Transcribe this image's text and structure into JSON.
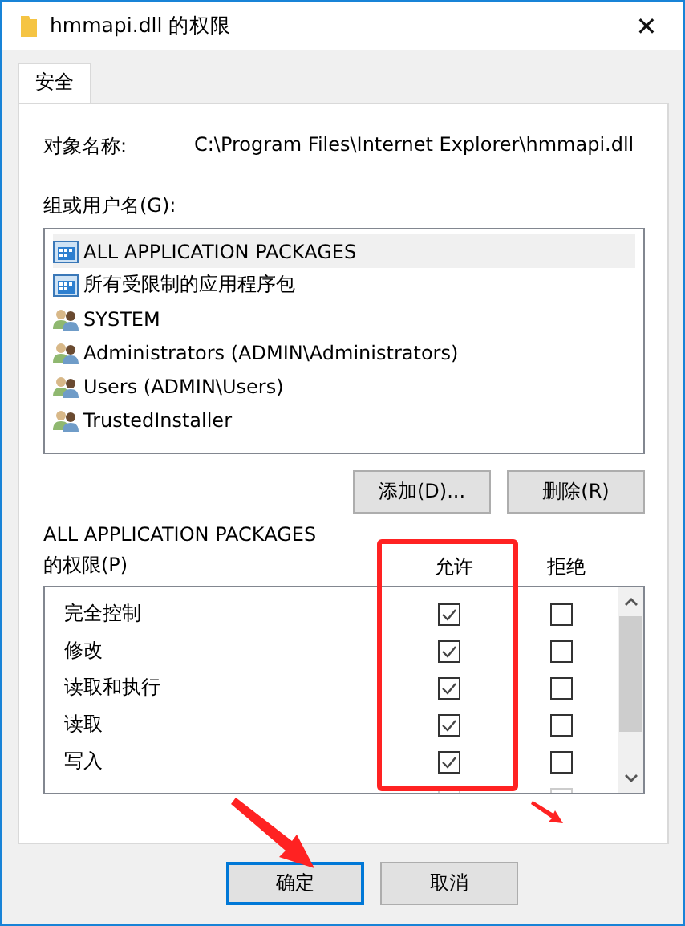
{
  "window": {
    "title": "hmmapi.dll 的权限",
    "close": "✕"
  },
  "tabs": [
    {
      "label": "安全",
      "selected": true
    }
  ],
  "object": {
    "label": "对象名称:",
    "value": "C:\\Program Files\\Internet Explorer\\hmmapi.dll"
  },
  "principals": {
    "label": "组或用户名(G):",
    "items": [
      {
        "name": "ALL APPLICATION PACKAGES",
        "kind": "package",
        "selected": true
      },
      {
        "name": "所有受限制的应用程序包",
        "kind": "package",
        "selected": false
      },
      {
        "name": "SYSTEM",
        "kind": "group",
        "selected": false
      },
      {
        "name": "Administrators (ADMIN\\Administrators)",
        "kind": "group",
        "selected": false
      },
      {
        "name": "Users (ADMIN\\Users)",
        "kind": "group",
        "selected": false
      },
      {
        "name": "TrustedInstaller",
        "kind": "group",
        "selected": false
      }
    ]
  },
  "principal_buttons": [
    "添加(D)...",
    "删除(R)"
  ],
  "permissions": {
    "label_line1": "ALL APPLICATION PACKAGES",
    "label_line2": "的权限(P)",
    "allow_header": "允许",
    "deny_header": "拒绝",
    "rows": [
      {
        "name": "完全控制",
        "allow": true,
        "deny": false,
        "disabled": false
      },
      {
        "name": "修改",
        "allow": true,
        "deny": false,
        "disabled": false
      },
      {
        "name": "读取和执行",
        "allow": true,
        "deny": false,
        "disabled": false
      },
      {
        "name": "读取",
        "allow": true,
        "deny": false,
        "disabled": false
      },
      {
        "name": "写入",
        "allow": true,
        "deny": false,
        "disabled": false
      },
      {
        "disabled": true
      }
    ]
  },
  "dialog_buttons": [
    {
      "label": "确定",
      "selected": true
    },
    {
      "label": "取消",
      "selected": false
    }
  ]
}
